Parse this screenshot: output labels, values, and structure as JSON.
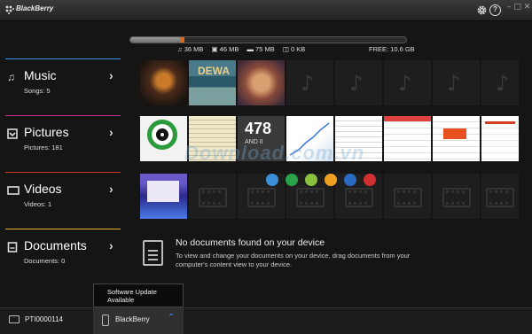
{
  "app": {
    "title": "BlackBerry",
    "help_label": "?"
  },
  "storage": {
    "used_fraction": 0.19,
    "music_fraction_at": 0.18,
    "legend": [
      "36 MB",
      "46 MB",
      "75 MB",
      "0 KB"
    ],
    "free": "FREE: 10.6 GB"
  },
  "nav": [
    {
      "label": "Music",
      "sub": "Songs: 5",
      "accent": "#3a8de0",
      "icon": "music-note"
    },
    {
      "label": "Pictures",
      "sub": "Pictures: 181",
      "accent": "#c0358a",
      "icon": "picture"
    },
    {
      "label": "Videos",
      "sub": "Videos: 1",
      "accent": "#d23a2a",
      "icon": "video"
    },
    {
      "label": "Documents",
      "sub": "Documents: 0",
      "accent": "#f0b22a",
      "icon": "document"
    }
  ],
  "documents": {
    "title": "No documents found on your device",
    "desc": "To view and change your documents on your device, drag documents from your computer's content view to your device."
  },
  "watermark": {
    "text": "Download.com.vn",
    "dots": [
      "#3b8fd8",
      "#2aa24a",
      "#8ac13f",
      "#f0a020",
      "#2a6bc0",
      "#d03030"
    ]
  },
  "status": {
    "device_id": "PTI0000114",
    "device_name": "BlackBerry",
    "popup": "Software Update Available"
  },
  "colors": {
    "accent_blue": "#3d8fe0",
    "storage_music": "#e0661f"
  }
}
